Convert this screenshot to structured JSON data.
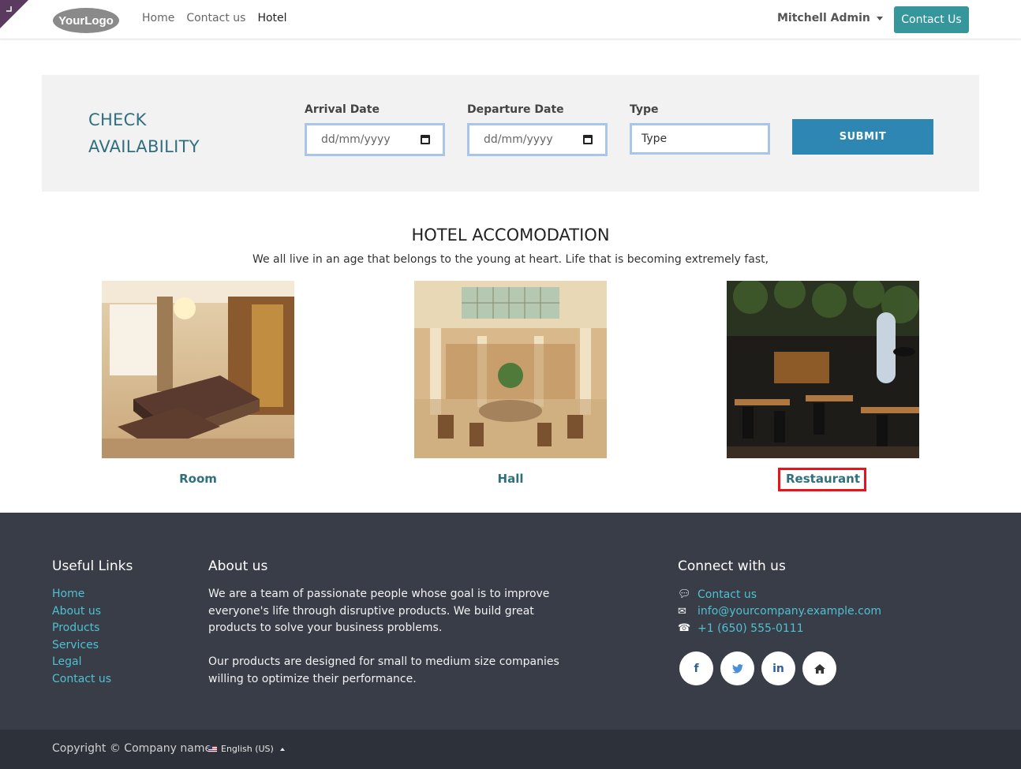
{
  "header": {
    "logo_text": "YourLogo",
    "nav": [
      "Home",
      "Contact us",
      "Hotel"
    ],
    "active_nav": "Hotel",
    "user_name": "Mitchell Admin",
    "contact_button": "Contact Us"
  },
  "availability": {
    "title_line1": "CHECK",
    "title_line2": "AVAILABILITY",
    "arrival_label": "Arrival Date",
    "arrival_placeholder": "dd/mm/yyyy",
    "departure_label": "Departure Date",
    "departure_placeholder": "dd/mm/yyyy",
    "type_label": "Type",
    "type_value": "Type",
    "submit_label": "SUBMIT"
  },
  "accommodation": {
    "title": "HOTEL ACCOMODATION",
    "subtitle": "We all live in an age that belongs to the young at heart. Life that is becoming extremely fast,",
    "items": [
      {
        "label": "Room"
      },
      {
        "label": "Hall"
      },
      {
        "label": "Restaurant"
      }
    ]
  },
  "footer": {
    "useful_links_title": "Useful Links",
    "links": [
      "Home",
      "About us",
      "Products",
      "Services",
      "Legal",
      "Contact us"
    ],
    "about_title": "About us",
    "about_p1": "We are a team of passionate people whose goal is to improve everyone's life through disruptive products. We build great products to solve your business problems.",
    "about_p2": "Our products are designed for small to medium size companies willing to optimize their performance.",
    "connect_title": "Connect with us",
    "contact_link": "Contact us",
    "email": "info@yourcompany.example.com",
    "phone": "+1 (650) 555-0111",
    "socials": [
      "facebook-icon",
      "twitter-icon",
      "linkedin-icon",
      "home-icon"
    ]
  },
  "copyright": {
    "text": "Copyright © Company name",
    "language": "English (US)"
  },
  "colors": {
    "accent_teal": "#35979c",
    "title_teal": "#2f6f7e",
    "submit_blue": "#2e86b3",
    "footer_bg": "#383d47",
    "link_cyan": "#4fc1d2",
    "highlight_red": "#e8141a"
  }
}
